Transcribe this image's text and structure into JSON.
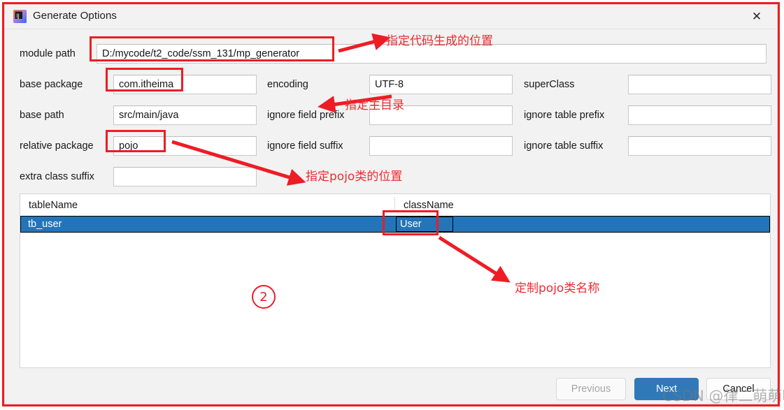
{
  "window": {
    "title": "Generate Options",
    "icon": "intellij-idea-icon",
    "close_label": "✕",
    "frame_color": "#ee1c25"
  },
  "form": {
    "fields": [
      {
        "name": "module-path",
        "label": "module path",
        "value": "D:/mycode/t2_code/ssm_131/mp_generator",
        "placeholder": ""
      },
      {
        "name": "base-package",
        "label": "base package",
        "value": "com.itheima",
        "placeholder": ""
      },
      {
        "name": "encoding",
        "label": "encoding",
        "value": "UTF-8",
        "placeholder": ""
      },
      {
        "name": "super-class",
        "label": "superClass",
        "value": "",
        "placeholder": ""
      },
      {
        "name": "base-path",
        "label": "base path",
        "value": "src/main/java",
        "placeholder": ""
      },
      {
        "name": "ignore-field-prefix",
        "label": "ignore field prefix",
        "value": "",
        "placeholder": ""
      },
      {
        "name": "ignore-table-prefix",
        "label": "ignore table prefix",
        "value": "",
        "placeholder": ""
      },
      {
        "name": "relative-package",
        "label": "relative package",
        "value": "pojo",
        "placeholder": ""
      },
      {
        "name": "ignore-field-suffix",
        "label": "ignore field suffix",
        "value": "",
        "placeholder": ""
      },
      {
        "name": "ignore-table-suffix",
        "label": "ignore table suffix",
        "value": "",
        "placeholder": ""
      },
      {
        "name": "extra-class-suffix",
        "label": "extra class suffix",
        "value": "",
        "placeholder": ""
      }
    ]
  },
  "table": {
    "columns": [
      "tableName",
      "className"
    ],
    "rows": [
      {
        "tableName": "tb_user",
        "className": "User",
        "selected": true
      }
    ]
  },
  "footer": {
    "previous_label": "Previous",
    "next_label": "Next",
    "cancel_label": "Cancel"
  },
  "annotations": {
    "note_code_location": "指定代码生成的位置",
    "note_main_dir": "指定主目录",
    "note_pojo_location": "指定pojo类的位置",
    "note_pojo_name": "定制pojo类名称",
    "step_marker": "2",
    "marker_color": "#ee1c25"
  },
  "watermark": {
    "text": "CSDN @律二萌萌哒"
  }
}
